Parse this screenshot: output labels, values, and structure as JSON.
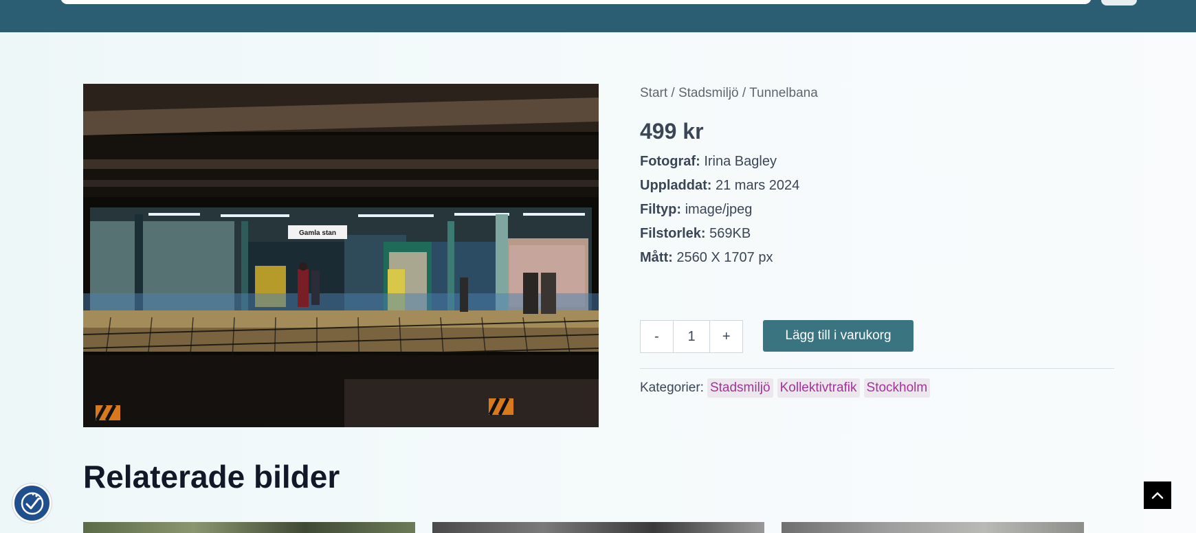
{
  "breadcrumb": {
    "items": [
      "Start",
      "Stadsmiljö",
      "Tunnelbana"
    ],
    "separator": "/"
  },
  "product": {
    "price": "499 kr",
    "image_sign_text": "Gamla stan",
    "meta": [
      {
        "label": "Fotograf:",
        "value": "Irina Bagley"
      },
      {
        "label": "Uppladdat:",
        "value": "21 mars 2024"
      },
      {
        "label": "Filtyp:",
        "value": "image/jpeg"
      },
      {
        "label": "Filstorlek:",
        "value": "569KB"
      },
      {
        "label": "Mått:",
        "value": "2560 X 1707 px"
      }
    ]
  },
  "cart": {
    "minus_label": "-",
    "quantity": "1",
    "plus_label": "+",
    "add_label": "Lägg till i varukorg"
  },
  "categories": {
    "label": "Kategorier:",
    "items": [
      "Stadsmiljö",
      "Kollektivtrafik",
      "Stockholm"
    ]
  },
  "related": {
    "title": "Relaterade bilder"
  },
  "icons": {
    "accessibility": "accessibility-icon",
    "scroll_top": "chevron-up-icon"
  },
  "colors": {
    "header": "#2c5e73",
    "button": "#3a7480",
    "category_text": "#a3339a",
    "accessibility": "#1f4f8c"
  }
}
